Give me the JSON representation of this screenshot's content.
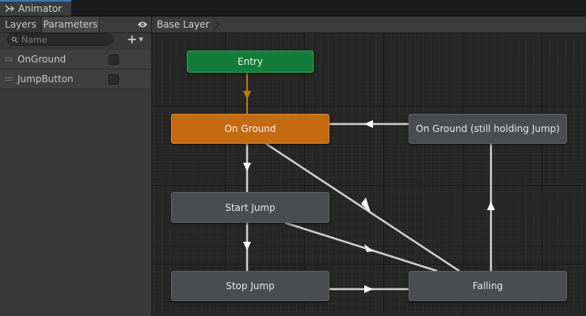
{
  "window": {
    "tab_title": "Animator"
  },
  "left_panel": {
    "tabs": [
      {
        "label": "Layers"
      },
      {
        "label": "Parameters"
      }
    ],
    "search_placeholder": "Name",
    "add_label": "+",
    "parameters": [
      {
        "name": "OnGround",
        "checked": false
      },
      {
        "name": "JumpButton",
        "checked": false
      }
    ]
  },
  "breadcrumb": {
    "layer": "Base Layer"
  },
  "graph": {
    "states": {
      "entry": "Entry",
      "on_ground": "On Ground",
      "on_ground_holding": "On Ground (still holding Jump)",
      "start_jump": "Start Jump",
      "stop_jump": "Stop Jump",
      "falling": "Falling"
    }
  },
  "colors": {
    "default_state": "#c66a12",
    "entry_state": "#147c3a",
    "state": "#4b4c4f",
    "transition": "#d0d0d0",
    "entry_transition": "#b97a10",
    "tab_accent": "#3a79bb"
  }
}
